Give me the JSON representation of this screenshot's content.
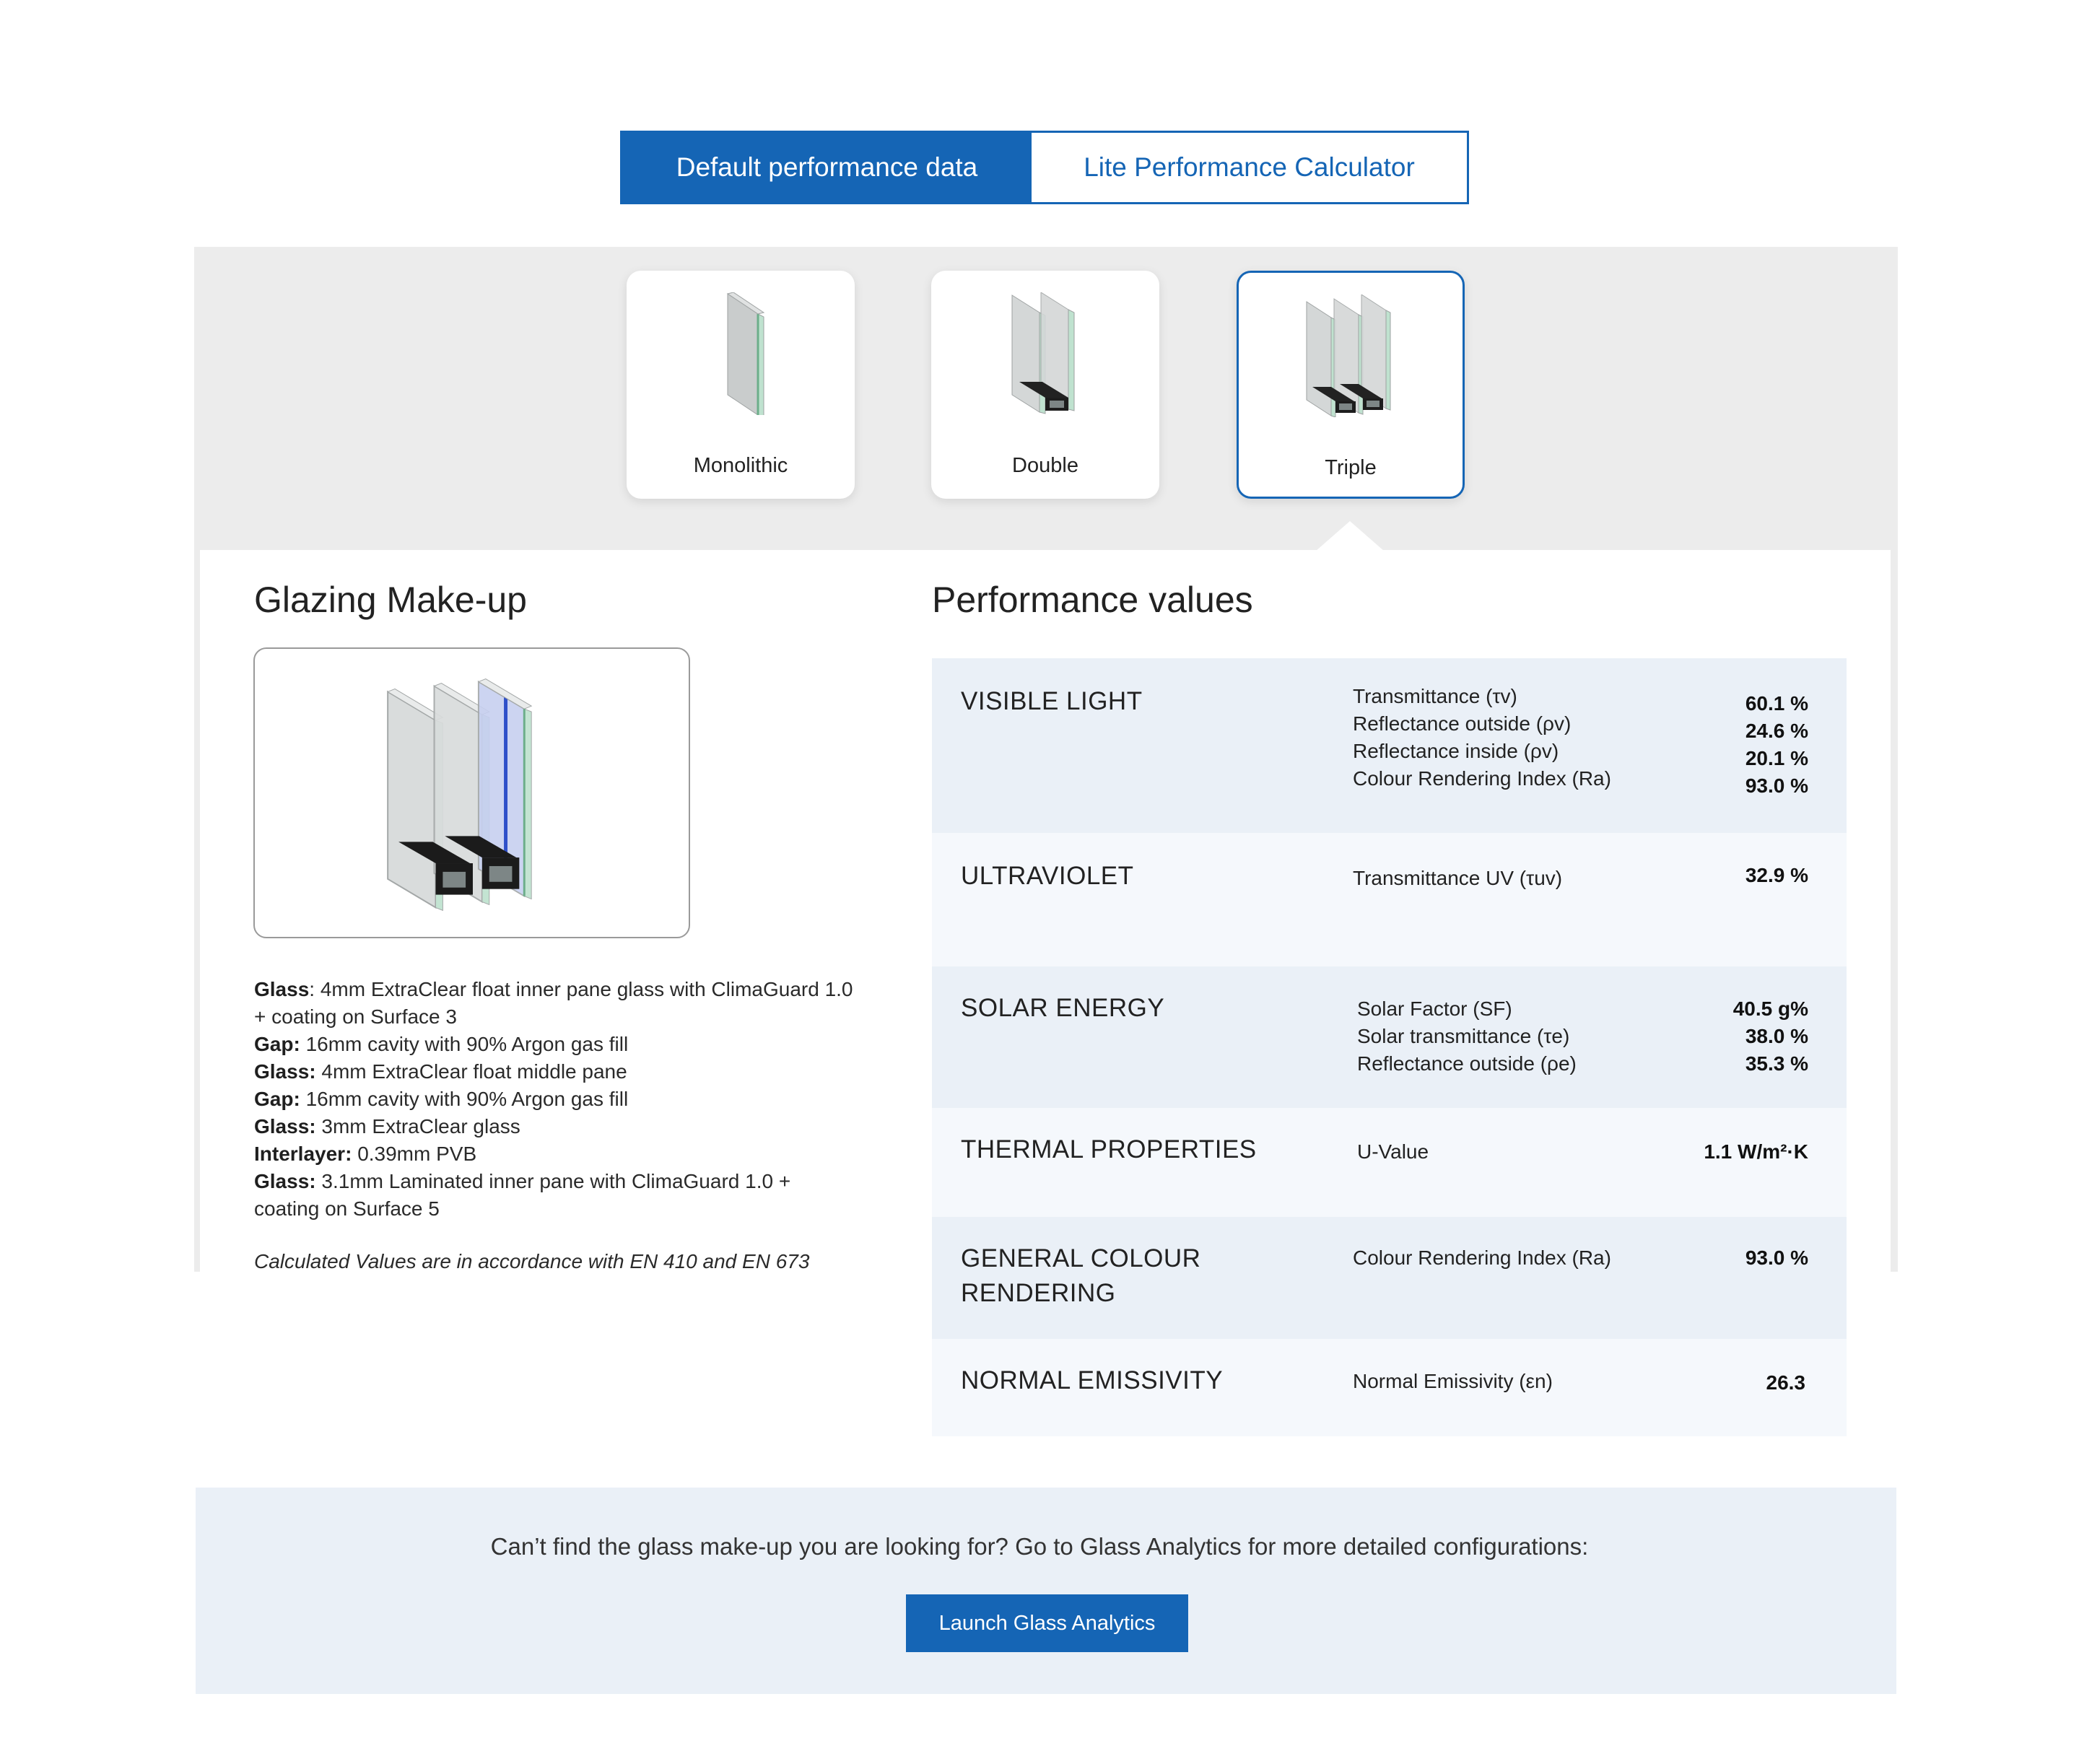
{
  "tabs": {
    "default_label": "Default performance data",
    "calculator_label": "Lite Performance Calculator"
  },
  "glass_types": [
    {
      "label": "Monolithic",
      "icon": "monolithic-glass-icon"
    },
    {
      "label": "Double",
      "icon": "double-glazing-icon"
    },
    {
      "label": "Triple",
      "icon": "triple-glazing-icon",
      "selected": true
    }
  ],
  "makeup": {
    "heading": "Glazing Make-up",
    "lines": [
      {
        "key": "Glass",
        "sep": ": ",
        "text": "4mm ExtraClear float inner pane glass with ClimaGuard 1.0 + coating on Surface 3"
      },
      {
        "key": "Gap:",
        "sep": " ",
        "text": "16mm cavity with 90% Argon gas fill"
      },
      {
        "key": "Glass:",
        "sep": " ",
        "text": "4mm ExtraClear float middle pane"
      },
      {
        "key": "Gap:",
        "sep": " ",
        "text": "16mm cavity with 90% Argon gas fill"
      },
      {
        "key": "Glass:",
        "sep": " ",
        "text": "3mm ExtraClear glass"
      },
      {
        "key": "Interlayer:",
        "sep": " ",
        "text": "0.39mm PVB"
      },
      {
        "key": "Glass:",
        "sep": " ",
        "text": "3.1mm Laminated inner pane with ClimaGuard 1.0 + coating on Surface 5"
      }
    ],
    "note": "Calculated Values are in accordance with EN 410 and EN 673"
  },
  "performance": {
    "heading": "Performance values",
    "rows": [
      {
        "category": "VISIBLE LIGHT",
        "labels": [
          "Transmittance (τv)",
          "Reflectance outside (ρv)",
          "Reflectance inside (ρv)",
          "Colour Rendering Index (Ra)"
        ],
        "values": [
          "60.1 %",
          "24.6 %",
          "20.1 %",
          "93.0 %"
        ]
      },
      {
        "category": "ULTRAVIOLET",
        "labels": [
          "Transmittance UV (τuv)"
        ],
        "values": [
          "32.9 %"
        ]
      },
      {
        "category": "SOLAR ENERGY",
        "labels": [
          "Solar Factor (SF)",
          "Solar transmittance (τe)",
          "Reflectance outside (ρe)"
        ],
        "values": [
          "40.5 g%",
          "38.0 %",
          "35.3 %"
        ]
      },
      {
        "category": "THERMAL PROPERTIES",
        "labels": [
          "U-Value"
        ],
        "values": [
          "1.1 W/m²·K"
        ]
      },
      {
        "category": "GENERAL COLOUR RENDERING",
        "labels": [
          "Colour Rendering Index (Ra)"
        ],
        "values": [
          "93.0 %"
        ]
      },
      {
        "category": "NORMAL EMISSIVITY",
        "labels": [
          "Normal Emissivity (εn)"
        ],
        "values": [
          "26.3"
        ]
      }
    ]
  },
  "cta": {
    "text": "Can’t find the glass make-up you are looking for? Go to Glass Analytics for more detailed configurations:",
    "button_label": "Launch Glass Analytics"
  },
  "colors": {
    "accent": "#1565b5",
    "panel_grey": "#ececec",
    "row_dark": "#eaf0f7",
    "row_light": "#f5f8fc"
  }
}
